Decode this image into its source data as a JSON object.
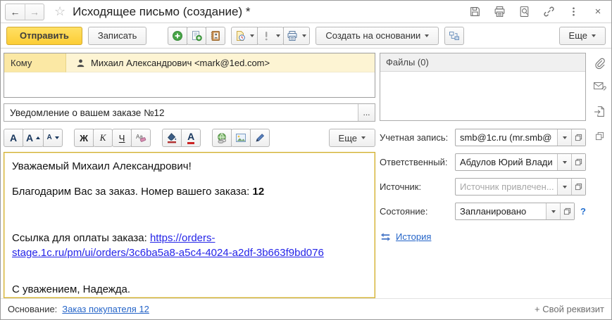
{
  "window": {
    "title": "Исходящее письмо (создание) *"
  },
  "glyphs": {
    "back": "←",
    "forward": "→",
    "star": "☆",
    "close": "×",
    "dots_button": "...",
    "help": "?"
  },
  "toolbar": {
    "send": "Отправить",
    "save": "Записать",
    "create_based_on": "Создать на основании",
    "more": "Еще"
  },
  "recipients": {
    "to_label": "Кому",
    "to_value": "Михаил Александрович <mark@1ed.com>"
  },
  "subject": {
    "value": "Уведомление о вашем заказе №12"
  },
  "format_toolbar": {
    "font": "А",
    "font_bigger": "А",
    "font_smaller": "А",
    "bold": "Ж",
    "italic": "К",
    "underline": "Ч",
    "color_letter": "А",
    "more": "Еще"
  },
  "files": {
    "header": "Файлы (0)"
  },
  "fields": {
    "account": {
      "label": "Учетная запись:",
      "value": "smb@1c.ru (mr.smb@"
    },
    "responsible": {
      "label": "Ответственный:",
      "value": "Абдулов Юрий Влади"
    },
    "source": {
      "label": "Источник:",
      "placeholder": "Источник привлечен..."
    },
    "state": {
      "label": "Состояние:",
      "value": "Запланировано"
    }
  },
  "history": {
    "label": "История"
  },
  "body": {
    "greeting": "Уважаемый Михаил Александрович!",
    "thanks_prefix": "Благодарим Вас за заказ. Номер вашего заказа: ",
    "order_number": "12",
    "link_prefix": "Ссылка для оплаты заказа: ",
    "link_text": "https://orders-stage.1c.ru/pm/ui/orders/3c6ba5a8-a5c4-4024-a2df-3b663f9bd076",
    "signature": "С уважением, Надежда."
  },
  "footer": {
    "base_label": "Основание:",
    "base_link": "Заказ покупателя 12",
    "custom_attr": "+ Свой реквизит"
  }
}
